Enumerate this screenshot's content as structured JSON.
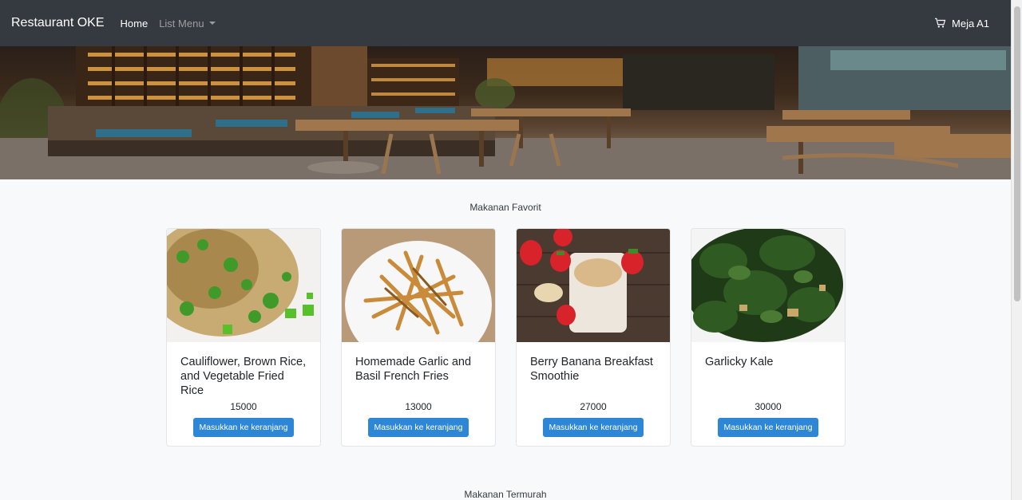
{
  "navbar": {
    "brand": "Restaurant OKE",
    "home": "Home",
    "list_menu": "List Menu",
    "table": "Meja A1"
  },
  "sections": {
    "favorit": "Makanan Favorit",
    "termurah": "Makanan Termurah"
  },
  "cards": [
    {
      "title": "Cauliflower, Brown Rice, and Vegetable Fried Rice",
      "price": "15000",
      "button": "Masukkan ke keranjang"
    },
    {
      "title": "Homemade Garlic and Basil French Fries",
      "price": "13000",
      "button": "Masukkan ke keranjang"
    },
    {
      "title": "Berry Banana Breakfast Smoothie",
      "price": "27000",
      "button": "Masukkan ke keranjang"
    },
    {
      "title": "Garlicky Kale",
      "price": "30000",
      "button": "Masukkan ke keranjang"
    }
  ],
  "colors": {
    "navbar": "#343a40",
    "button": "#2e86d6",
    "background": "#f8f9fa"
  }
}
